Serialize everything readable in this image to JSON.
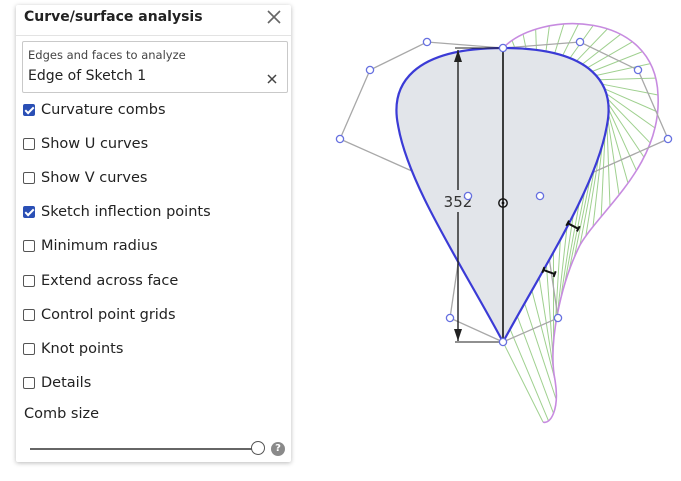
{
  "panel": {
    "title": "Curve/surface analysis",
    "selection": {
      "label": "Edges and faces to analyze",
      "value": "Edge of Sketch 1"
    },
    "options": [
      {
        "label": "Curvature combs",
        "checked": true
      },
      {
        "label": "Show U curves",
        "checked": false
      },
      {
        "label": "Show V curves",
        "checked": false
      },
      {
        "label": "Sketch inflection points",
        "checked": true
      },
      {
        "label": "Minimum radius",
        "checked": false
      },
      {
        "label": "Extend across face",
        "checked": false
      },
      {
        "label": "Control point grids",
        "checked": false
      },
      {
        "label": "Knot points",
        "checked": false
      },
      {
        "label": "Details",
        "checked": false
      }
    ],
    "comb_size_label": "Comb size",
    "comb_size_fraction": 1.0
  },
  "viewport": {
    "dimension_value": "352",
    "colors": {
      "curve": "#3b3bd6",
      "fill": "#e2e5ea",
      "comb_lines": "#9fd08f",
      "comb_envelope": "#c78be0",
      "control_polygon": "#a8a8a8",
      "control_points": "#6670e0"
    }
  }
}
